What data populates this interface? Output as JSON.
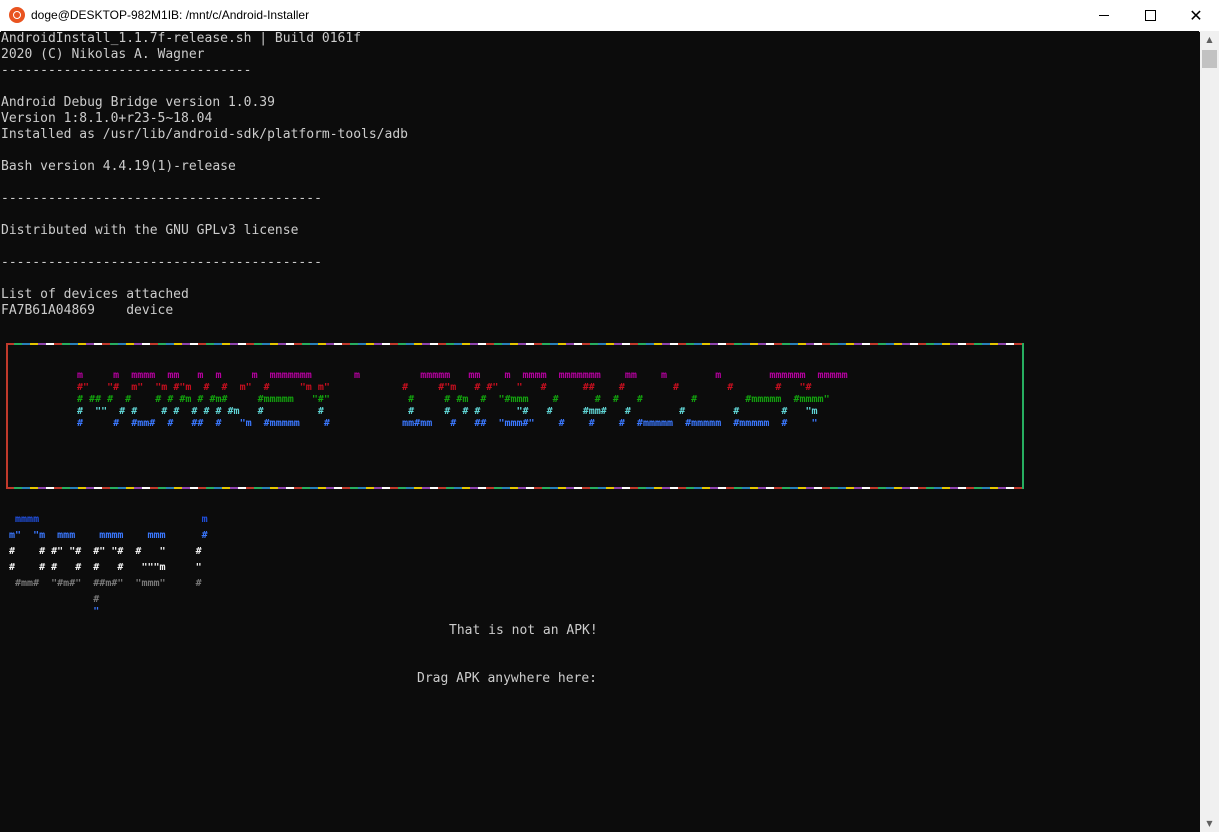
{
  "window": {
    "title": "doge@DESKTOP-982M1IB: /mnt/c/Android-Installer",
    "app_icon": "ubuntu-icon",
    "minimize_icon": "minimize-icon",
    "maximize_icon": "maximize-icon",
    "close_icon": "close-icon"
  },
  "terminal": {
    "lines": [
      "AndroidInstall_1.1.7f-release.sh | Build 0161f",
      "2020 (C) Nikolas A. Wagner",
      "--------------------------------",
      "",
      "Android Debug Bridge version 1.0.39",
      "Version 1:8.1.0+r23-5~18.04",
      "Installed as /usr/lib/android-sdk/platform-tools/adb",
      "",
      "Bash version 4.4.19(1)-release",
      "",
      "-----------------------------------------",
      "",
      "Distributed with the GNU GPLv3 license",
      "",
      "-----------------------------------------",
      "",
      "List of devices attached",
      "FA7B61A04869    device"
    ],
    "banner_art": [
      " m     m  mmmm  mm   m  m     m  mmmmmmm       m          mmmmm   mm    m  mmmm  mmmmmmm    mm    m        m        mmmmmm  mmmmm",
      " #\"   \"#  m\"  \"m #\"m  #  #  m\"  #     \"m m\"            #     #\"m   # #\"   \"   #      ##    #        #        #       #   \"#",
      " # ## #  #    # # #m # #m#     #mmmmm   \"#\"             #     # #m  #  \"#mmm    #      #  #   #        #        #mmmmm  #mmmm\"",
      " #  \"\"  # #    # #  # # # #m   #         #              #     #  # #      \"#   #     #mm#   #        #        #       #   \"m",
      " #     #  #mm#  #   ##  #   \"m  #mmmmm    #            mm#mm   #   ##  \"mmm#\"    #    #    #  #mmmmm  #mmmmm  #mmmmm  #    \""
    ],
    "logo_art": [
      " mmmm                           m",
      "m\"  \"m  mmm    mmmm    mmm      #",
      "#    # #\" \"#  #\" \"#  #   \"     #",
      "#    # #   #  #   #   \"\"\"m     \"",
      " #mm#  \"#m#\"  ##m#\"  \"mmm\"     #",
      "              #",
      "              \""
    ],
    "message": "That is not an APK!",
    "prompt": "Drag APK anywhere here:"
  }
}
